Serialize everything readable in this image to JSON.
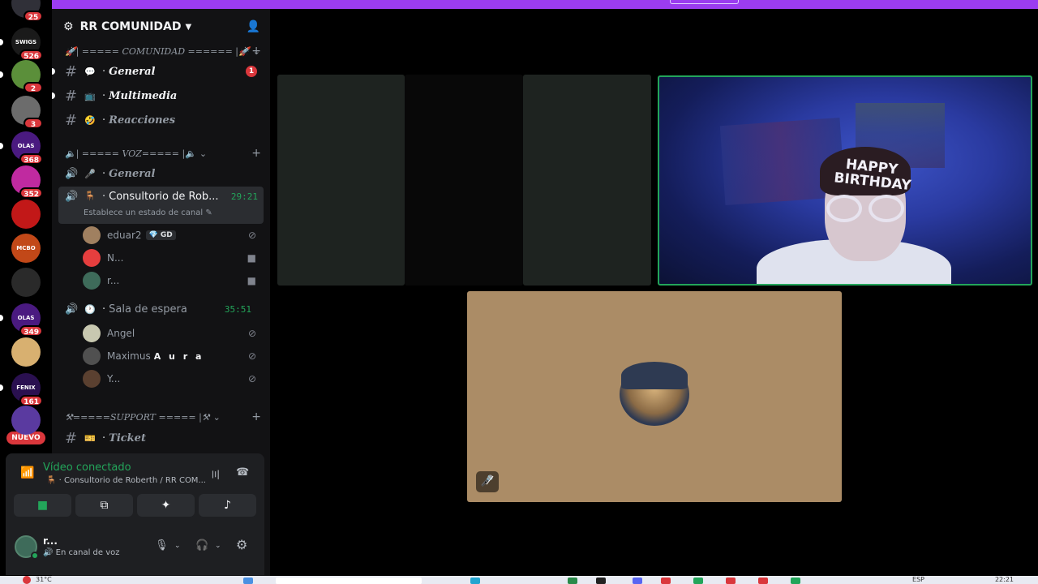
{
  "app": {
    "server_name": "RR COMUNIDAD"
  },
  "rail": {
    "servers": [
      {
        "badge": "25",
        "color": "#303038"
      },
      {
        "badge": "526",
        "color": "#1a1a1a",
        "label": "SWIGS"
      },
      {
        "badge": "2",
        "color": "#5b8f3a"
      },
      {
        "badge": "3",
        "color": "#6c6c6c"
      },
      {
        "badge": "368",
        "color": "#4a1a80",
        "label": "OLAS"
      },
      {
        "badge": "352",
        "color": "#c02aa0"
      },
      {
        "badge": "",
        "color": "#c21818"
      },
      {
        "badge": "",
        "color": "#c24818",
        "label": "MCBO"
      },
      {
        "badge": "",
        "color": "#2a2a2a"
      },
      {
        "badge": "349",
        "color": "#4a1a80",
        "label": "OLAS"
      },
      {
        "badge": "",
        "color": "#d8b070"
      },
      {
        "badge": "161",
        "color": "#2a1050",
        "label": "FENIX"
      },
      {
        "badge": "",
        "color": "#5a3aa0"
      }
    ],
    "new_label": "NUEVO"
  },
  "categories": {
    "comunidad": "| ===== COMUNIDAD ====== |",
    "voz": "| ===== VOZ===== |",
    "support": "=====SUPPORT ===== |"
  },
  "text_channels": {
    "general": {
      "emoji": "💬",
      "name": "General",
      "unread": "1"
    },
    "multimedia": {
      "emoji": "📺",
      "name": "Multimedia"
    },
    "reacciones": {
      "emoji": "🤣",
      "name": "Reacciones"
    },
    "ticket": {
      "emoji": "🎫",
      "name": "Ticket"
    }
  },
  "voice_channels": {
    "general": {
      "name": "General"
    },
    "consultorio": {
      "name": "Consultorio de Rob...",
      "timer": "29:21",
      "status": "Establece un estado de canal"
    },
    "sala": {
      "name": "Sala de espera",
      "timer": "35:51"
    }
  },
  "voice_users": {
    "consultorio": [
      {
        "name": "eduar2",
        "tag": "💎 GD",
        "color": "#a08060"
      },
      {
        "name": "N...",
        "color": "#e53e3e"
      },
      {
        "name": "r...",
        "color": "#3e6b5a"
      }
    ],
    "sala": [
      {
        "name": "Angel",
        "color": "#c8c8b0"
      },
      {
        "name": "Maximus",
        "tag": "A u r a",
        "color": "#505050"
      },
      {
        "name": "Y...",
        "color": "#5a4030"
      }
    ]
  },
  "voice_panel": {
    "title": "Vídeo conectado",
    "path": "Consultorio de Roberth / RR COM..."
  },
  "user_panel": {
    "name": "r...",
    "status": "En canal de voz"
  },
  "stage": {
    "banner_text": "HAPPY BIRTHDAY"
  },
  "taskbar": {
    "weather": "31°C",
    "lang": "ESP",
    "clock": "22:21"
  },
  "colors": {
    "accent_green": "#23a55a",
    "danger": "#da373c",
    "top_bar": "#9b3cf0"
  }
}
